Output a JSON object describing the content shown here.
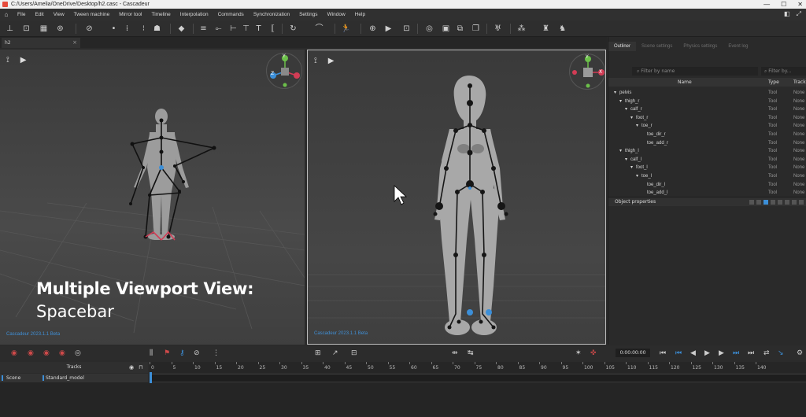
{
  "window": {
    "title": "C:/Users/Amelia/OneDrive/Desktop/h2.casc - Cascadeur",
    "buttons": [
      "—",
      "☐",
      "✕"
    ]
  },
  "menu": {
    "items": [
      "File",
      "Edit",
      "View",
      "Tween machine",
      "Mirror tool",
      "Timeline",
      "Interpolation",
      "Commands",
      "Synchronization",
      "Settings",
      "Window",
      "Help"
    ]
  },
  "document_tab": {
    "label": "h2",
    "close": "×"
  },
  "viewport_left": {
    "caption": "Cascadeur 2023.1.1 Beta"
  },
  "viewport_right": {
    "caption": "Cascadeur 2023.1.1 Beta"
  },
  "gizmo_axes": {
    "y": "Y",
    "z": "Z",
    "x": "X"
  },
  "overlay": {
    "title": "Multiple Viewport View:",
    "subtitle": "Spacebar"
  },
  "right_panel": {
    "tabs": [
      "Outliner",
      "Scene settings",
      "Physics settings",
      "Event log"
    ],
    "active_tab": "Outliner",
    "filter_name_placeholder": "Filter by name",
    "filter_other_placeholder": "Filter by...",
    "columns": {
      "name": "Name",
      "type": "Type",
      "track": "Track"
    },
    "tree": [
      {
        "name": "pelvis",
        "depth": 0,
        "arrow": "▾",
        "type": "Tool",
        "track": "None"
      },
      {
        "name": "thigh_r",
        "depth": 1,
        "arrow": "▾",
        "type": "Tool",
        "track": "None"
      },
      {
        "name": "calf_r",
        "depth": 2,
        "arrow": "▾",
        "type": "Tool",
        "track": "None"
      },
      {
        "name": "foot_r",
        "depth": 3,
        "arrow": "▾",
        "type": "Tool",
        "track": "None"
      },
      {
        "name": "toe_r",
        "depth": 4,
        "arrow": "▾",
        "type": "Tool",
        "track": "None"
      },
      {
        "name": "toe_dir_r",
        "depth": 5,
        "arrow": "",
        "type": "Tool",
        "track": "None"
      },
      {
        "name": "toe_add_r",
        "depth": 5,
        "arrow": "",
        "type": "Tool",
        "track": "None"
      },
      {
        "name": "thigh_l",
        "depth": 1,
        "arrow": "▾",
        "type": "Tool",
        "track": "None"
      },
      {
        "name": "calf_l",
        "depth": 2,
        "arrow": "▾",
        "type": "Tool",
        "track": "None"
      },
      {
        "name": "foot_l",
        "depth": 3,
        "arrow": "▾",
        "type": "Tool",
        "track": "None"
      },
      {
        "name": "toe_l",
        "depth": 4,
        "arrow": "▾",
        "type": "Tool",
        "track": "None"
      },
      {
        "name": "toe_dir_l",
        "depth": 5,
        "arrow": "",
        "type": "Tool",
        "track": "None"
      },
      {
        "name": "toe_add_l",
        "depth": 5,
        "arrow": "",
        "type": "Tool",
        "track": "None"
      }
    ],
    "object_properties": "Object properties"
  },
  "timeline": {
    "time": "0:00:00:00",
    "tracks_header": "Tracks",
    "scene_label": "Scene",
    "model_label": "Standard_model",
    "ruler": [
      "0",
      "5",
      "10",
      "15",
      "20",
      "25",
      "30",
      "35",
      "40",
      "45",
      "50",
      "55",
      "60",
      "65",
      "70",
      "75",
      "80",
      "85",
      "90",
      "95",
      "100",
      "105",
      "110",
      "115",
      "120",
      "125",
      "130",
      "135",
      "140"
    ]
  },
  "colors": {
    "accent_blue": "#3c8fd8",
    "joint_black": "#1b1b1b",
    "axis_red": "#d23c55",
    "axis_green": "#6cc04a",
    "axis_blue": "#3c8fd8"
  }
}
